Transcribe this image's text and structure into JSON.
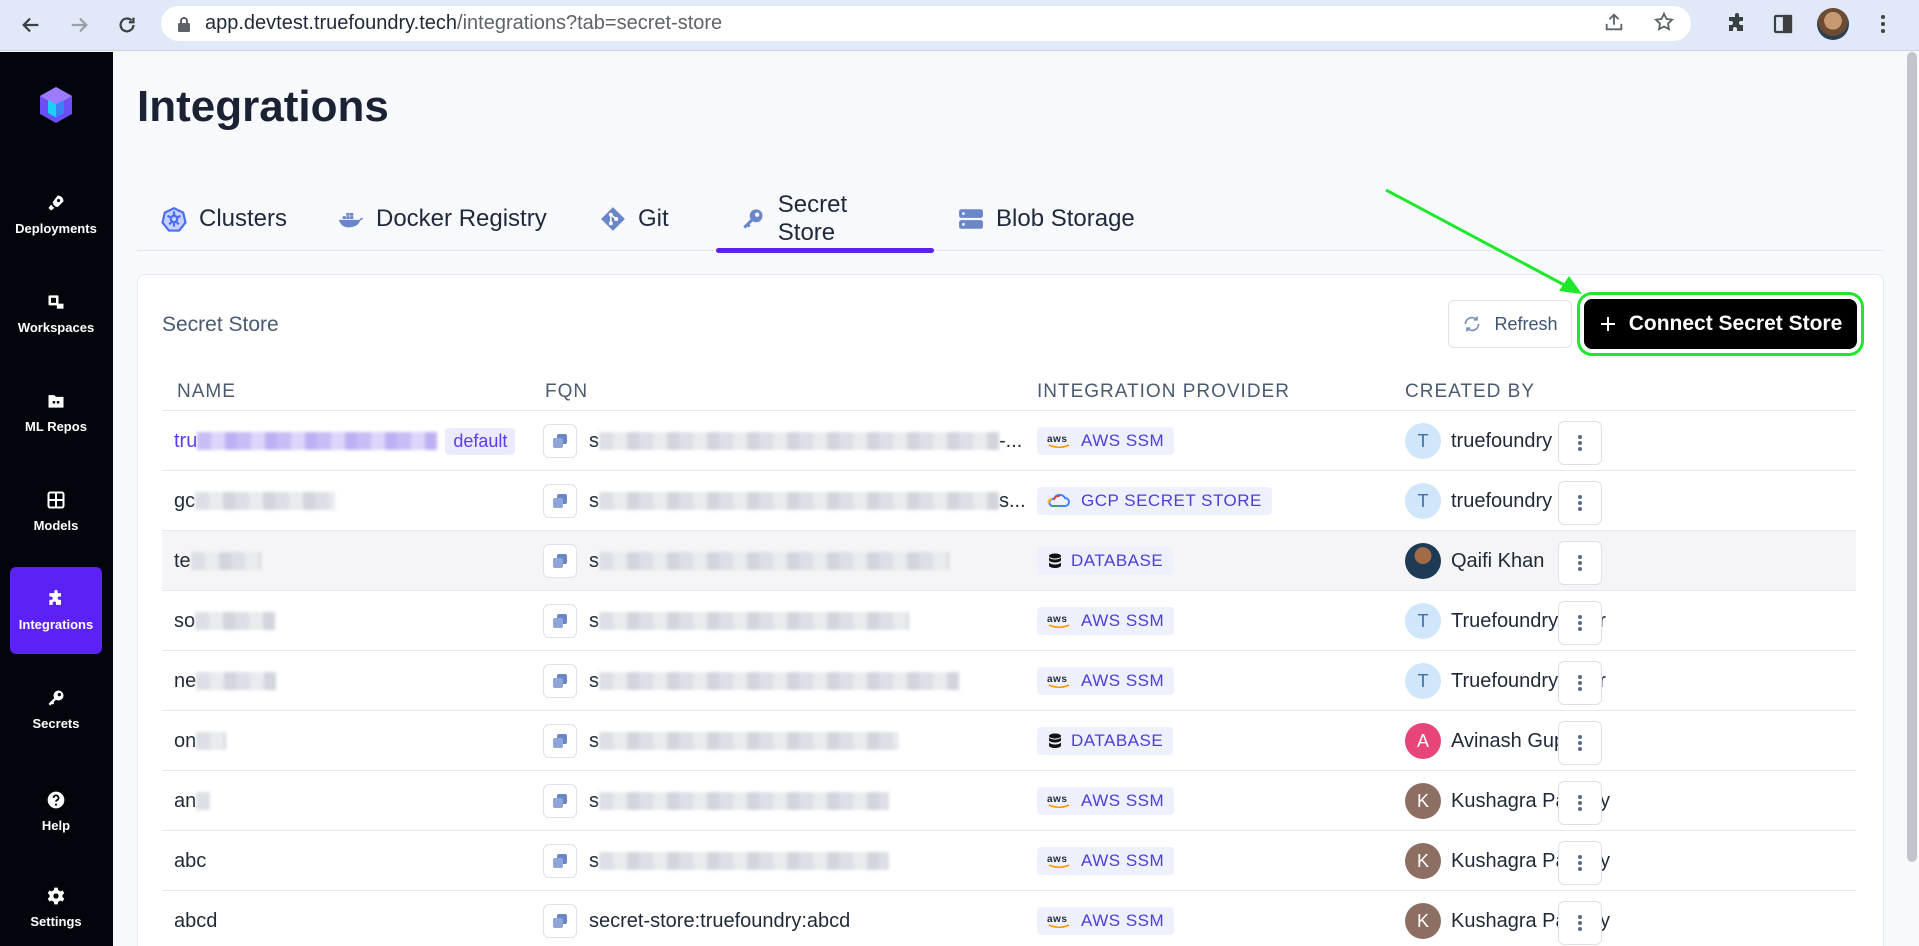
{
  "browser": {
    "url_host": "app.devtest.truefoundry.tech",
    "url_path": "/integrations?tab=secret-store"
  },
  "sidebar": {
    "items": [
      {
        "label": "Deployments",
        "icon": "rocket-icon"
      },
      {
        "label": "Workspaces",
        "icon": "workspaces-icon"
      },
      {
        "label": "ML Repos",
        "icon": "folder-icon"
      },
      {
        "label": "Models",
        "icon": "grid-icon"
      },
      {
        "label": "Integrations",
        "icon": "puzzle-icon",
        "active": true
      },
      {
        "label": "Secrets",
        "icon": "key-icon"
      },
      {
        "label": "Help",
        "icon": "help-icon"
      },
      {
        "label": "Settings",
        "icon": "gear-icon"
      }
    ]
  },
  "page": {
    "title": "Integrations",
    "tabs": [
      {
        "label": "Clusters"
      },
      {
        "label": "Docker Registry"
      },
      {
        "label": "Git"
      },
      {
        "label": "Secret Store",
        "active": true
      },
      {
        "label": "Blob Storage"
      }
    ]
  },
  "card": {
    "title": "Secret Store",
    "refresh_label": "Refresh",
    "connect_label": "Connect Secret Store",
    "columns": [
      "NAME",
      "FQN",
      "INTEGRATION PROVIDER",
      "CREATED BY"
    ],
    "default_badge": "default",
    "rows": [
      {
        "name_prefix": "tru",
        "fqn_prefix": "s",
        "fqn_suffix": "-...",
        "provider": "AWS SSM",
        "creator": "truefoundry",
        "avatar_letter": "T"
      },
      {
        "name_prefix": "gc",
        "fqn_prefix": "s",
        "fqn_suffix": "s...",
        "provider": "GCP SECRET STORE",
        "creator": "truefoundry",
        "avatar_letter": "T"
      },
      {
        "name_prefix": "te",
        "fqn_prefix": "s",
        "fqn_suffix": "",
        "provider": "DATABASE",
        "creator": "Qaifi Khan",
        "avatar_letter": ""
      },
      {
        "name_prefix": "so",
        "fqn_prefix": "s",
        "fqn_suffix": "",
        "provider": "AWS SSM",
        "creator": "Truefoundry User",
        "avatar_letter": "T"
      },
      {
        "name_prefix": "ne",
        "fqn_prefix": "s",
        "fqn_suffix": "",
        "provider": "AWS SSM",
        "creator": "Truefoundry User",
        "avatar_letter": "T"
      },
      {
        "name_prefix": "on",
        "fqn_prefix": "s",
        "fqn_suffix": "",
        "provider": "DATABASE",
        "creator": "Avinash Gupta",
        "avatar_letter": "A"
      },
      {
        "name_prefix": "an",
        "fqn_prefix": "s",
        "fqn_suffix": "",
        "provider": "AWS SSM",
        "creator": "Kushagra Pandey",
        "avatar_letter": "K"
      },
      {
        "name_prefix": "abc",
        "fqn_prefix": "s",
        "fqn_suffix": "",
        "provider": "AWS SSM",
        "creator": "Kushagra Pandey",
        "avatar_letter": "K"
      },
      {
        "name_prefix": "abcd",
        "fqn_prefix": "secret-store:truefoundry:abcd",
        "fqn_suffix": "",
        "provider": "AWS SSM",
        "creator": "Kushagra Pandey",
        "avatar_letter": "K"
      }
    ]
  },
  "colors": {
    "accent": "#5b21f5",
    "sidebar_bg": "#03050d",
    "highlight": "#1ee82b"
  }
}
